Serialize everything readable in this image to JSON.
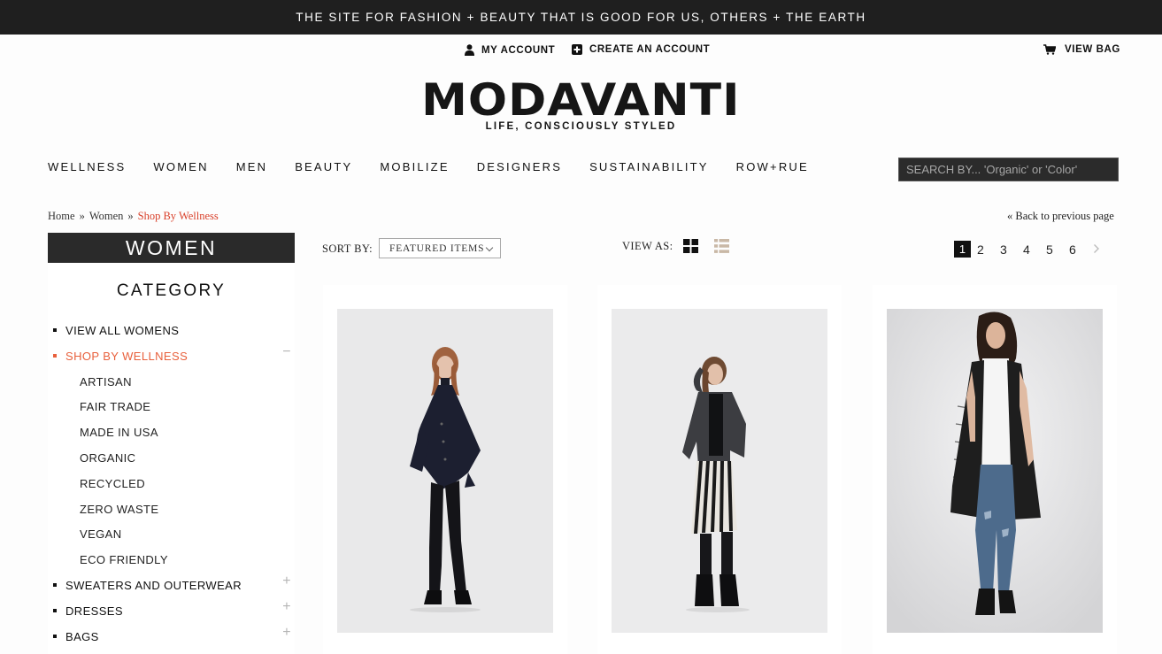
{
  "announcement": "THE SITE FOR FASHION + BEAUTY THAT IS GOOD FOR US, OTHERS + THE EARTH",
  "account": {
    "my_account": "MY ACCOUNT",
    "create_account": "CREATE AN ACCOUNT",
    "view_bag": "VIEW BAG"
  },
  "logo": {
    "name": "MODAVANTI",
    "tagline": "LIFE, CONSCIOUSLY STYLED"
  },
  "nav": [
    "WELLNESS",
    "WOMEN",
    "MEN",
    "BEAUTY",
    "MOBILIZE",
    "DESIGNERS",
    "SUSTAINABILITY",
    "ROW+RUE"
  ],
  "search": {
    "placeholder": "SEARCH BY... 'Organic' or 'Color'"
  },
  "breadcrumb": {
    "items": [
      "Home",
      "Women",
      "Shop By Wellness"
    ],
    "separator": "»"
  },
  "back_link": "« Back to previous page",
  "sidebar": {
    "title": "WOMEN",
    "heading": "CATEGORY",
    "categories": [
      {
        "label": "VIEW ALL WOMENS",
        "toggle": ""
      },
      {
        "label": "SHOP BY WELLNESS",
        "toggle": "−",
        "active": true,
        "subitems": [
          "ARTISAN",
          "FAIR TRADE",
          "MADE IN USA",
          "ORGANIC",
          "RECYCLED",
          "ZERO WASTE",
          "VEGAN",
          "ECO FRIENDLY"
        ]
      },
      {
        "label": "SWEATERS AND OUTERWEAR",
        "toggle": "+"
      },
      {
        "label": "DRESSES",
        "toggle": "+"
      },
      {
        "label": "BAGS",
        "toggle": "+"
      }
    ]
  },
  "toolbar": {
    "sort_label": "SORT BY:",
    "sort_value": "FEATURED ITEMS",
    "view_label": "VIEW AS:"
  },
  "pagination": {
    "current": "1",
    "pages": [
      "2",
      "3",
      "4",
      "5",
      "6"
    ],
    "next": "›"
  },
  "products": [
    {
      "image": "model-black-poncho-cardigan"
    },
    {
      "image": "model-striped-skirt-blazer"
    },
    {
      "image": "model-long-black-vest-jeans"
    }
  ],
  "colors": {
    "top_bar": "#1f1f1f",
    "accent": "#e8603c",
    "breadcrumb_current": "#d9412b"
  }
}
